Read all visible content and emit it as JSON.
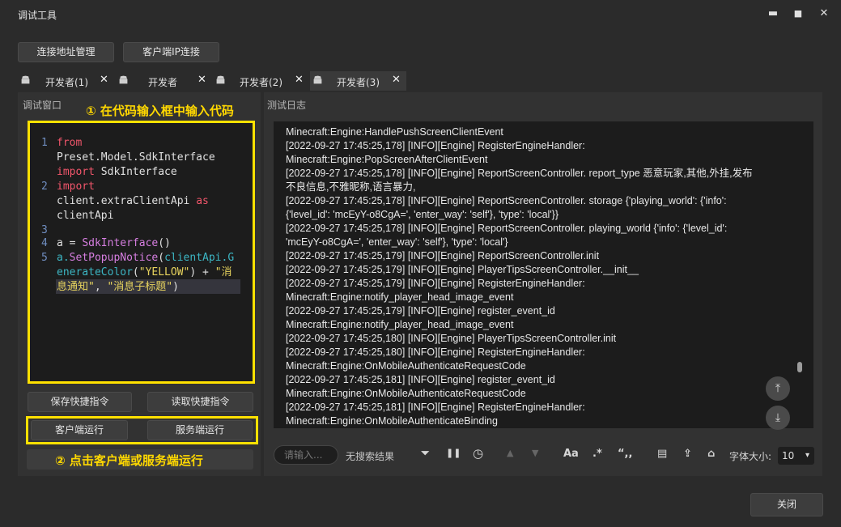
{
  "window": {
    "title": "调试工具",
    "minimize": "▬",
    "maximize": "■",
    "close": "✕"
  },
  "toolbar": {
    "address_manage": "连接地址管理",
    "client_ip_connect": "客户端IP连接"
  },
  "tabs": [
    {
      "label": "开发者(1)",
      "close": "✕"
    },
    {
      "label": "开发者",
      "close": "✕"
    },
    {
      "label": "开发者(2)",
      "close": "✕"
    },
    {
      "label": "开发者(3)",
      "close": "✕"
    }
  ],
  "debug_panel": {
    "header": "调试窗口",
    "annotation_1": "① 在代码输入框中输入代码",
    "annotation_2": "② 点击客户端或服务端运行"
  },
  "code": {
    "line_numbers": [
      "1",
      "2",
      "3",
      "4",
      "5"
    ],
    "l1a": "from",
    "l1b": "Preset.Model.SdkInterface",
    "l1c_kw": "import",
    "l1c": " SdkInterface",
    "l2a": "import",
    "l2b": "client.extraClientApi",
    "l2b_kw": " as",
    "l2c": "clientApi",
    "l4a": "a = ",
    "l4b": "SdkInterface",
    "l4c": "()",
    "l5a": "a.",
    "l5b": "SetPopupNotice",
    "l5c": "(",
    "l5d": "clientApi.G",
    "l6a": "enerateColor",
    "l6b": "(",
    "l6c": "\"YELLOW\"",
    "l6d": ") + ",
    "l6e": "\"消",
    "l7a": "息通知\"",
    "l7b": ", ",
    "l7c": "\"消息子标题\"",
    "l7d": ")"
  },
  "buttons": {
    "save_shortcut": "保存快捷指令",
    "load_shortcut": "读取快捷指令",
    "client_run": "客户端运行",
    "server_run": "服务端运行",
    "close": "关闭"
  },
  "log_panel": {
    "header": "测试日志",
    "lines": [
      "Minecraft:Engine:HandlePushScreenClientEvent",
      "[2022-09-27 17:45:25,178] [INFO][Engine] RegisterEngineHandler:",
      "Minecraft:Engine:PopScreenAfterClientEvent",
      "[2022-09-27 17:45:25,178] [INFO][Engine] ReportScreenController. report_type 恶意玩家,其他,外挂,发布",
      "不良信息,不雅昵称,语言暴力,",
      "[2022-09-27 17:45:25,178] [INFO][Engine] ReportScreenController. storage {'playing_world': {'info':",
      "{'level_id': 'mcEyY-o8CgA=', 'enter_way': 'self'}, 'type': 'local'}}",
      "[2022-09-27 17:45:25,178] [INFO][Engine] ReportScreenController. playing_world {'info': {'level_id':",
      "'mcEyY-o8CgA=', 'enter_way': 'self'}, 'type': 'local'}",
      "[2022-09-27 17:45:25,179] [INFO][Engine] ReportScreenController.init",
      "[2022-09-27 17:45:25,179] [INFO][Engine] PlayerTipsScreenController.__init__",
      "[2022-09-27 17:45:25,179] [INFO][Engine] RegisterEngineHandler:",
      "Minecraft:Engine:notify_player_head_image_event",
      "[2022-09-27 17:45:25,179] [INFO][Engine] register_event_id",
      "Minecraft:Engine:notify_player_head_image_event",
      "[2022-09-27 17:45:25,180] [INFO][Engine] PlayerTipsScreenController.init",
      "[2022-09-27 17:45:25,180] [INFO][Engine] RegisterEngineHandler:",
      "Minecraft:Engine:OnMobileAuthenticateRequestCode",
      "[2022-09-27 17:45:25,181] [INFO][Engine] register_event_id",
      "Minecraft:Engine:OnMobileAuthenticateRequestCode",
      "[2022-09-27 17:45:25,181] [INFO][Engine] RegisterEngineHandler:",
      "Minecraft:Engine:OnMobileAuthenticateBinding"
    ],
    "scroll_top": "⤒",
    "scroll_bottom": "⤓"
  },
  "search": {
    "placeholder": "请输入...",
    "no_result": "无搜索结果",
    "font_size_label": "字体大小:",
    "font_size_value": "10",
    "tools": [
      "filter-icon",
      "pause-icon",
      "history-icon",
      "arrow-up-icon",
      "arrow-down-icon",
      "match-case-icon",
      "regex-icon",
      "quote-icon",
      "copy-icon",
      "export-icon",
      "clear-icon"
    ],
    "glyphs": {
      "filter": "⏷",
      "pause": "❚❚",
      "history": "◷",
      "up": "▲",
      "down": "▼",
      "case": "Aa",
      "regex": ".*",
      "quote": "“,,",
      "copy": "▤",
      "export": "⇪",
      "clear": "⌂",
      "dropdown": "▾"
    }
  }
}
